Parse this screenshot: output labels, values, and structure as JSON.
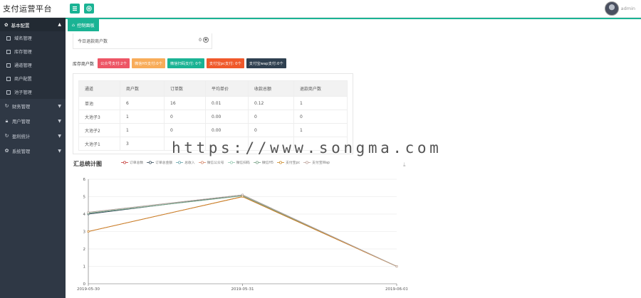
{
  "app": {
    "title": "支付运营平台",
    "user": "admin"
  },
  "topbar": {
    "menu_icon": "menu-icon",
    "add_icon": "plus-icon"
  },
  "sidebar": {
    "section": "基本配置",
    "sub_items": [
      "域名管理",
      "库存管理",
      "通道管理",
      "商户配置",
      "池子管理"
    ],
    "items": [
      {
        "label": "财务管理",
        "icon": "refresh-icon"
      },
      {
        "label": "用户管理",
        "icon": "lock-icon"
      },
      {
        "label": "盈利统计",
        "icon": "refresh-icon"
      },
      {
        "label": "系统管理",
        "icon": "gear-icon"
      }
    ]
  },
  "tabs": [
    {
      "label": "控制面板",
      "icon": "home-icon"
    }
  ],
  "mini_card": {
    "label": "今日退款商户数",
    "value": "0"
  },
  "stock": {
    "label": "库存商户数",
    "badges": [
      {
        "text": "公众号支付:2个",
        "color": "#ed5565"
      },
      {
        "text": "微信H5支付:0个",
        "color": "#f8ac59"
      },
      {
        "text": "微信扫码支付: 0个",
        "color": "#1ab394"
      },
      {
        "text": "支付宝pc支付: 0个",
        "color": "#f0592b"
      },
      {
        "text": "支付宝wap支付:0个",
        "color": "#2f4050"
      }
    ]
  },
  "table": {
    "headers": [
      "通道",
      "商户数",
      "订单数",
      "平均单价",
      "收款总额",
      "退款商户数"
    ],
    "rows": [
      [
        "单池",
        "6",
        "16",
        "0.01",
        "0.12",
        "1"
      ],
      [
        "大池子3",
        "1",
        "0",
        "0.00",
        "0",
        "0"
      ],
      [
        "大池子2",
        "1",
        "0",
        "0.00",
        "0",
        "1"
      ],
      [
        "大池子1",
        "3",
        "",
        "",
        "",
        ""
      ]
    ]
  },
  "watermark": "https://www.songma.com",
  "chart": {
    "title": "汇总统计图",
    "legend": [
      {
        "name": "订单总数",
        "color": "#c23531"
      },
      {
        "name": "订单总金额",
        "color": "#2f4554"
      },
      {
        "name": "总收入",
        "color": "#61a0a8"
      },
      {
        "name": "微信公众号",
        "color": "#d48265"
      },
      {
        "name": "微信扫码",
        "color": "#91c7ae"
      },
      {
        "name": "微信H5",
        "color": "#749f83"
      },
      {
        "name": "支付宝pc",
        "color": "#ca8622"
      },
      {
        "name": "支付宝Wap",
        "color": "#bda29a"
      }
    ]
  },
  "chart_data": {
    "type": "line",
    "title": "汇总统计图",
    "x": [
      "2019-05-30",
      "2019-05-31",
      "2019-06-01"
    ],
    "ylim": [
      0,
      6
    ],
    "yticks": [
      0,
      1,
      2,
      3,
      4,
      5,
      6
    ],
    "grid": true,
    "legend_position": "top",
    "series": [
      {
        "name": "订单总数",
        "values": [
          3,
          5,
          1
        ]
      },
      {
        "name": "订单总金额",
        "values": [
          4,
          5.1,
          1
        ]
      },
      {
        "name": "总收入",
        "values": [
          4.1,
          5.1,
          1
        ]
      },
      {
        "name": "微信公众号",
        "values": [
          3,
          5,
          1
        ]
      },
      {
        "name": "微信扫码",
        "values": [
          4.05,
          5.05,
          1
        ]
      },
      {
        "name": "微信H5",
        "values": [
          4.05,
          5.05,
          1
        ]
      },
      {
        "name": "支付宝pc",
        "values": [
          3,
          5,
          1
        ]
      },
      {
        "name": "支付宝Wap",
        "values": [
          4.1,
          5.1,
          1
        ]
      }
    ]
  }
}
